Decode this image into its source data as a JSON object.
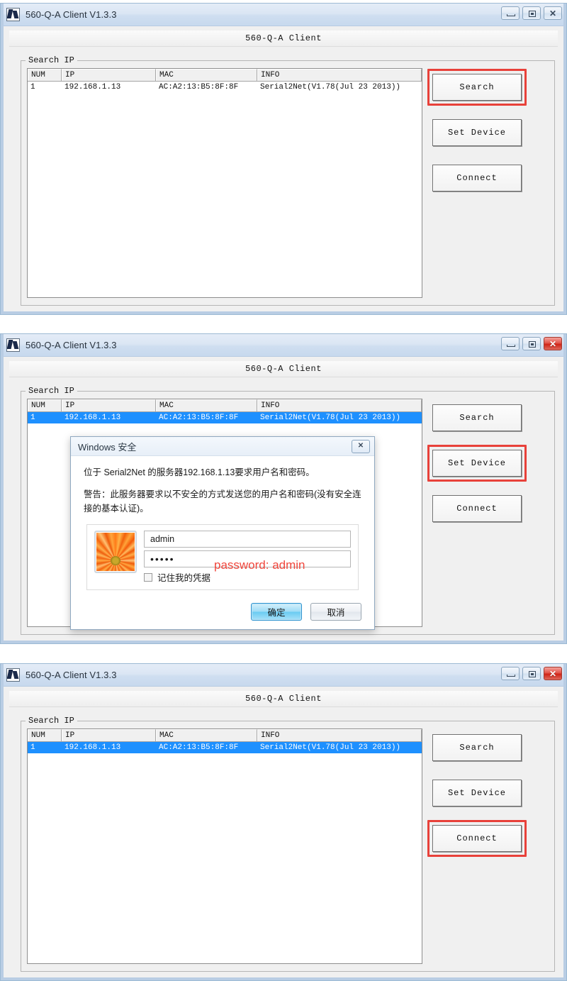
{
  "app": {
    "title": "560-Q-A Client V1.3.3",
    "banner": "560-Q-A Client",
    "icon": "app-icon"
  },
  "window_controls": {
    "minimize": "minimize-icon",
    "maximize": "maximize-icon",
    "close": "close-icon"
  },
  "groupbox": {
    "title": "Search IP"
  },
  "table": {
    "columns": [
      "NUM",
      "IP",
      "MAC",
      "INFO"
    ],
    "rows": [
      {
        "num": "1",
        "ip": "192.168.1.13",
        "mac": "AC:A2:13:B5:8F:8F",
        "info": "Serial2Net(V1.78(Jul 23 2013))"
      }
    ]
  },
  "buttons": {
    "search": "Search",
    "set_device": "Set Device",
    "connect": "Connect"
  },
  "panels": [
    {
      "id": "panel-1",
      "highlight": "search",
      "row_selected": false
    },
    {
      "id": "panel-2",
      "highlight": "set_device",
      "row_selected": true
    },
    {
      "id": "panel-3",
      "highlight": "connect",
      "row_selected": true
    }
  ],
  "dialog": {
    "title": "Windows 安全",
    "close": "close-icon",
    "message_line1": "位于 Serial2Net 的服务器192.168.1.13要求用户名和密码。",
    "message_line2": "警告：此服务器要求以不安全的方式发送您的用户名和密码(没有安全连接的基本认证)。",
    "avatar": "user-flower-avatar",
    "username_value": "admin",
    "password_value": "•••••",
    "remember_label": "记住我的凭据",
    "remember_checked": false,
    "ok_label": "确定",
    "cancel_label": "取消",
    "annotation": "password:  admin"
  },
  "colors": {
    "highlight_box": "#e8413a",
    "selected_row": "#1e90ff",
    "annotation": "#f0463c",
    "close_button": "#cf2417"
  }
}
